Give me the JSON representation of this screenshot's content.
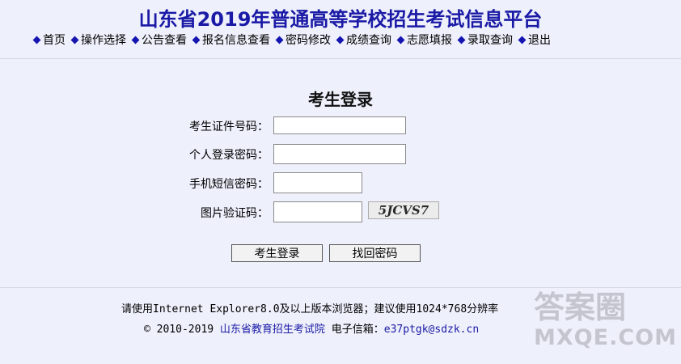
{
  "header": {
    "title": "山东省2019年普通高等学校招生考试信息平台"
  },
  "nav": {
    "items": [
      {
        "label": "首页",
        "icon": "diamond-bullet"
      },
      {
        "label": "操作选择",
        "icon": "diamond-bullet"
      },
      {
        "label": "公告查看",
        "icon": "diamond-bullet"
      },
      {
        "label": "报名信息查看",
        "icon": "diamond-bullet"
      },
      {
        "label": "密码修改",
        "icon": "diamond-bullet"
      },
      {
        "label": "成绩查询",
        "icon": "diamond-bullet"
      },
      {
        "label": "志愿填报",
        "icon": "diamond-bullet"
      },
      {
        "label": "录取查询",
        "icon": "diamond-bullet"
      },
      {
        "label": "退出",
        "icon": "diamond-bullet"
      }
    ]
  },
  "login": {
    "title": "考生登录",
    "fields": {
      "exam_id_label": "考生证件号码：",
      "exam_id_value": "",
      "password_label": "个人登录密码：",
      "password_value": "",
      "sms_label": "手机短信密码：",
      "sms_value": "",
      "captcha_label": "图片验证码：",
      "captcha_value": ""
    },
    "captcha_text": "5JCVS7",
    "login_button": "考生登录",
    "recover_button": "找回密码"
  },
  "footer": {
    "browser_note": "请使用Internet Explorer8.0及以上版本浏览器；建议使用1024*768分辨率",
    "copyright": "© 2010-2019 ",
    "org_link": "山东省教育招生考试院",
    "email_label": " 电子信箱：",
    "email": "e37ptgk@sdzk.cn"
  },
  "watermark": {
    "line1": "答案圈",
    "line2": "MXQE.COM"
  },
  "colors": {
    "title": "#1a1aa6",
    "background": "#eef0fb",
    "bullet": "#1515b0"
  }
}
